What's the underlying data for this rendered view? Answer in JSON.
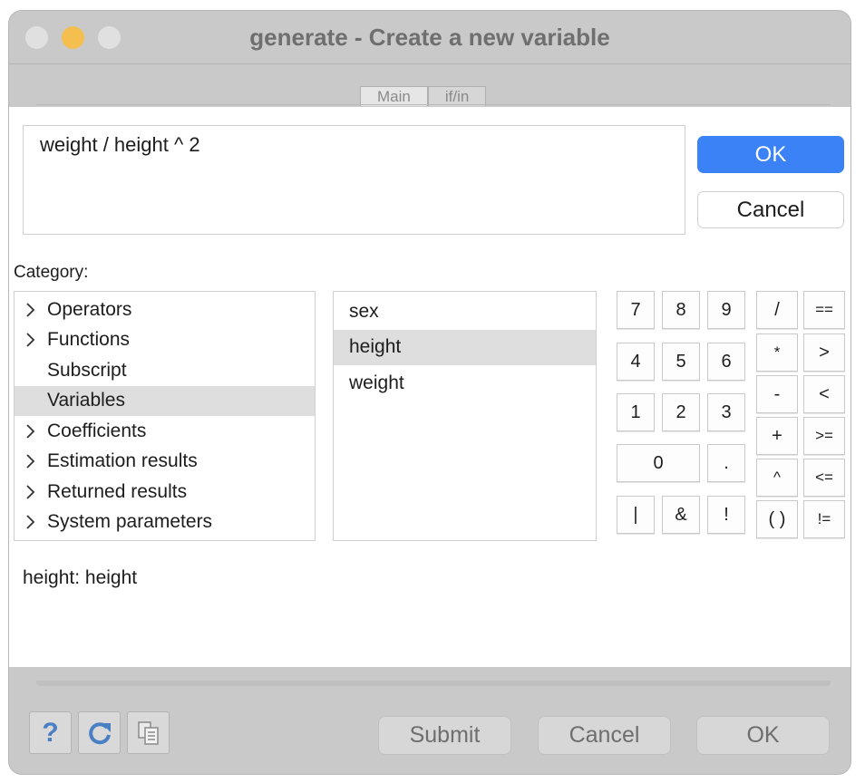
{
  "window": {
    "title": "generate - Create a new variable",
    "traffic_lights": {
      "close": "#e0e0e0",
      "minimize": "#f5bf4f",
      "zoom": "#e0e0e0"
    }
  },
  "tabs": [
    {
      "label": "Main",
      "active": true
    },
    {
      "label": "if/in",
      "active": false
    }
  ],
  "expression": {
    "value": "weight / height ^ 2"
  },
  "buttons": {
    "ok": "OK",
    "cancel": "Cancel"
  },
  "category": {
    "label": "Category:",
    "items": [
      {
        "label": "Operators",
        "expandable": true
      },
      {
        "label": "Functions",
        "expandable": true
      },
      {
        "label": "Subscript",
        "expandable": false
      },
      {
        "label": "Variables",
        "expandable": false,
        "selected": true
      },
      {
        "label": "Coefficients",
        "expandable": true
      },
      {
        "label": "Estimation results",
        "expandable": true
      },
      {
        "label": "Returned results",
        "expandable": true
      },
      {
        "label": "System parameters",
        "expandable": true
      }
    ]
  },
  "variables": {
    "items": [
      {
        "label": "sex"
      },
      {
        "label": "height",
        "selected": true
      },
      {
        "label": "weight"
      }
    ]
  },
  "keypad": {
    "digits": [
      "7",
      "8",
      "9",
      "4",
      "5",
      "6",
      "1",
      "2",
      "3",
      "0",
      ".",
      "|",
      "&",
      "!"
    ],
    "operators": [
      "/",
      "==",
      "*",
      ">",
      "-",
      "<",
      "+",
      ">=",
      "^",
      "<=",
      "( )",
      "!="
    ]
  },
  "description": "height:  height",
  "footer": {
    "icons": [
      "help-icon",
      "reset-icon",
      "copy-icon"
    ],
    "help_glyph": "?",
    "submit": "Submit",
    "cancel": "Cancel",
    "ok": "OK"
  },
  "colors": {
    "accent": "#3b82f6",
    "selection": "#dedede",
    "chrome": "#c9c9c9"
  }
}
